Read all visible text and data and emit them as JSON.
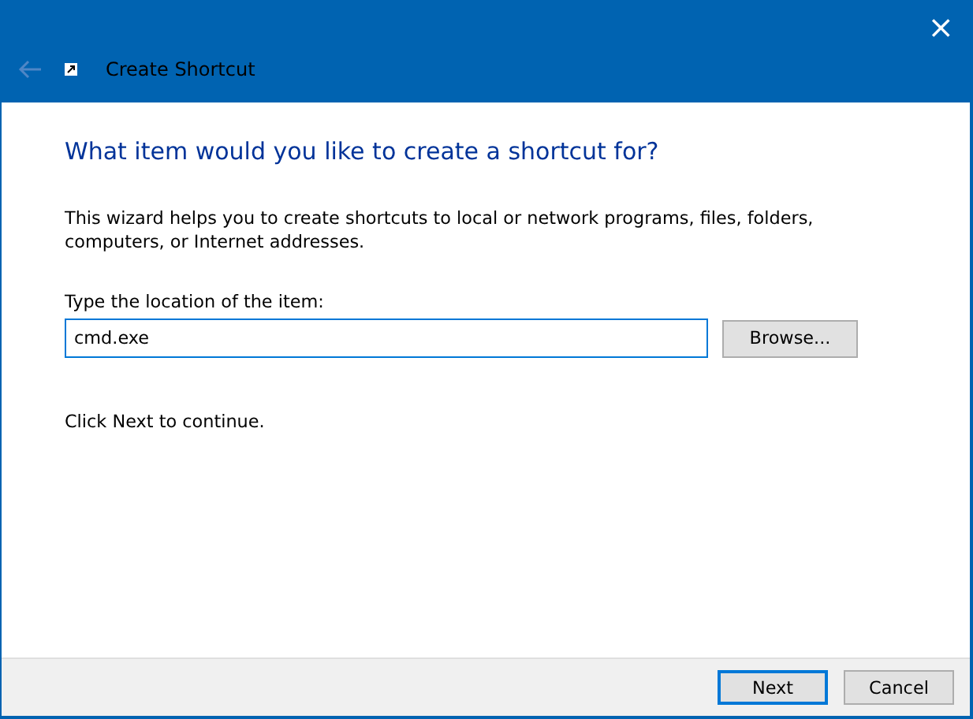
{
  "window": {
    "title": "Create Shortcut",
    "close": "×",
    "back_disabled": true
  },
  "heading": "What item would you like to create a shortcut for?",
  "description": "This wizard helps you to create shortcuts to local or network programs, files, folders, computers, or Internet addresses.",
  "location": {
    "label": "Type the location of the item:",
    "value": "cmd.exe",
    "focused": true
  },
  "browse_button": "Browse...",
  "hint": "Click Next to continue.",
  "buttons": [
    {
      "label": "Next",
      "default": true
    },
    {
      "label": "Cancel",
      "default": false
    }
  ]
}
